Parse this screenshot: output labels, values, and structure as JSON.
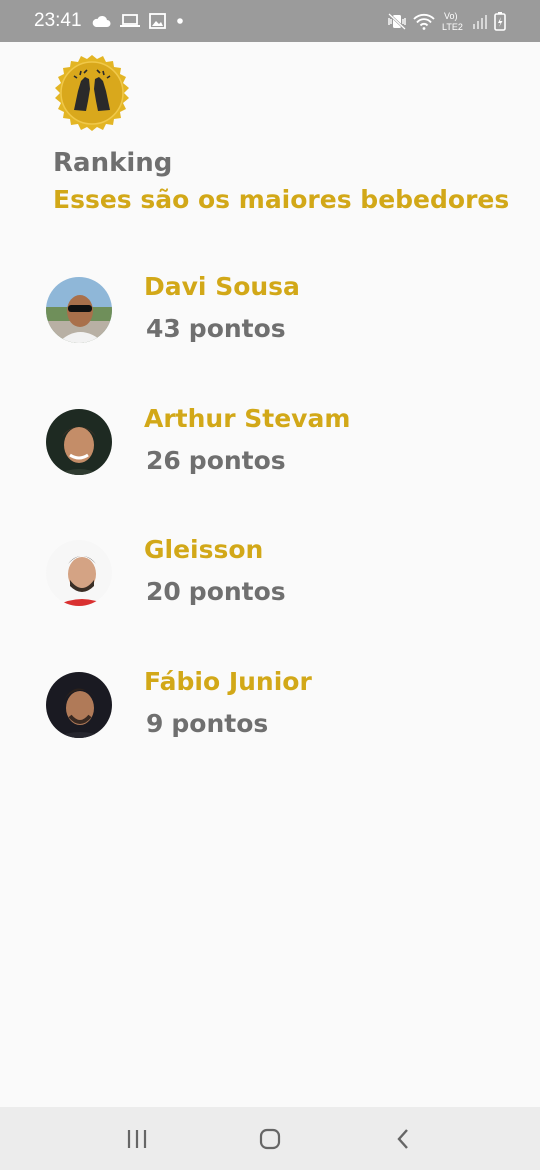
{
  "status_bar": {
    "time": "23:41",
    "icons": [
      "cloud-icon",
      "laptop-icon",
      "image-icon",
      "dot-icon",
      "mute-vibrate-icon",
      "wifi-icon",
      "volte-icon",
      "signal-icon",
      "battery-icon"
    ],
    "volte_label": "Vo)",
    "lte_label": "LTE2"
  },
  "header": {
    "logo_icon": "beer-cheers-bottlecap-icon",
    "title": "Ranking",
    "subtitle": "Esses são os maiores bebedores",
    "accent_color": "#d2a818",
    "title_color": "#6f6f6f"
  },
  "ranking": {
    "items": [
      {
        "name": "Davi Sousa",
        "points": "43",
        "unit": "pontos"
      },
      {
        "name": "Arthur Stevam",
        "points": "26",
        "unit": "pontos"
      },
      {
        "name": "Gleisson",
        "points": "20",
        "unit": "pontos"
      },
      {
        "name": "Fábio Junior",
        "points": "9",
        "unit": "pontos"
      }
    ]
  },
  "nav_bar": {
    "icons": [
      "recent-apps-icon",
      "home-icon",
      "back-icon"
    ]
  }
}
